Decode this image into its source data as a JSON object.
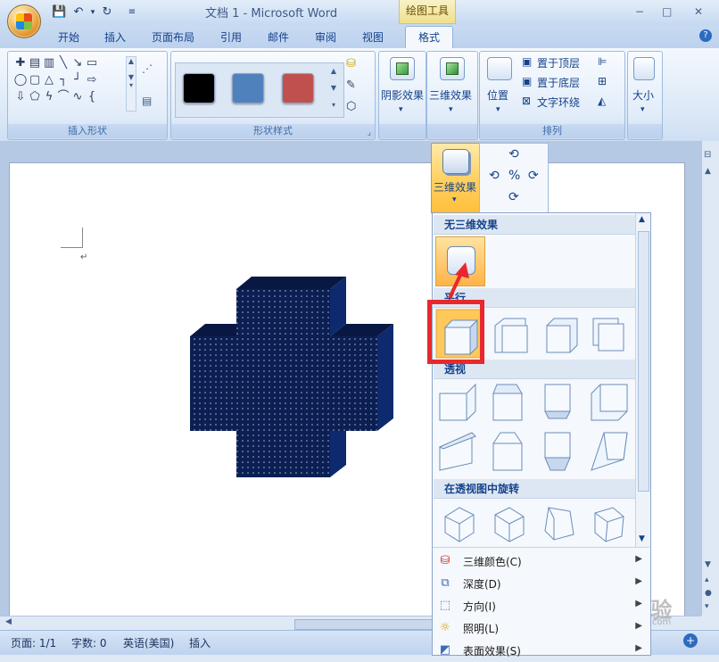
{
  "window": {
    "title": "文档 1 - Microsoft Word",
    "contextual_tab_group": "绘图工具",
    "controls": {
      "minimize": "−",
      "restore": "□",
      "close": "✕"
    }
  },
  "tabs": [
    "开始",
    "插入",
    "页面布局",
    "引用",
    "邮件",
    "审阅",
    "视图",
    "格式"
  ],
  "active_tab": "格式",
  "ribbon": {
    "groups": {
      "insert_shapes": "插入形状",
      "shape_styles": "形状样式",
      "arrange": "排列"
    },
    "shape_style_colors": [
      "#000000",
      "#4f81bd",
      "#c0504d"
    ],
    "buttons": {
      "shadow_effects": "阴影效果",
      "threed_effects": "三维效果",
      "position": "位置",
      "bring_to_front": "置于顶层",
      "send_to_back": "置于底层",
      "text_wrapping": "文字环绕",
      "size": "大小"
    }
  },
  "dropdown": {
    "button_label": "三维效果",
    "sections": {
      "none": "无三维效果",
      "parallel": "平行",
      "perspective": "透视",
      "rotate_perspective": "在透视图中旋转"
    },
    "menu_items": [
      {
        "label": "三维颜色(C)",
        "icon": "fill-bucket-icon"
      },
      {
        "label": "深度(D)",
        "icon": "depth-icon"
      },
      {
        "label": "方向(I)",
        "icon": "direction-icon"
      },
      {
        "label": "照明(L)",
        "icon": "lighting-icon"
      },
      {
        "label": "表面效果(S)",
        "icon": "surface-icon"
      }
    ]
  },
  "document": {
    "shape_color": "#0b1f52",
    "shape_fill": "dotted pattern"
  },
  "statusbar": {
    "page": "页面: 1/1",
    "words": "字数: 0",
    "language": "英语(美国)",
    "mode": "插入"
  },
  "watermark": "Baidu 经验",
  "watermark_sub": "jingyan.baidu.com",
  "colors": {
    "accent": "#15428b",
    "highlight": "#e8282d",
    "selected_tile": "#ffc85a"
  }
}
